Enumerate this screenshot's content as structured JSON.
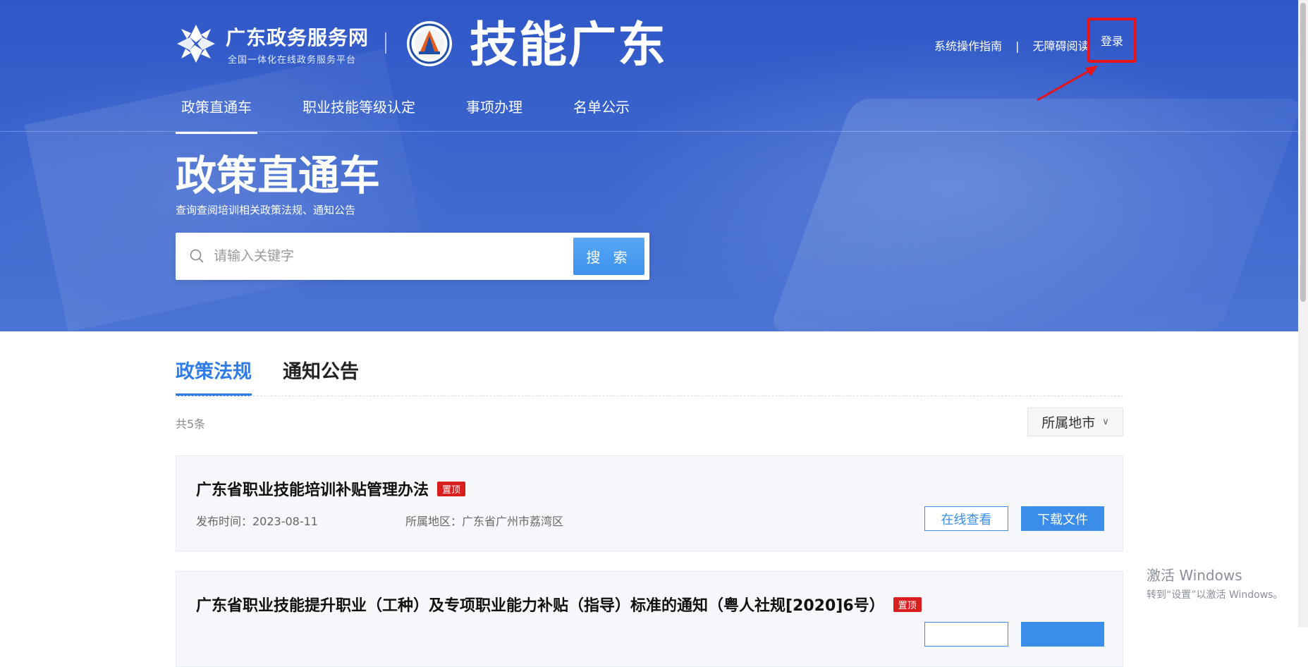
{
  "header": {
    "portal_name": "广东政务服务网",
    "portal_tagline": "全国一体化在线政务服务平台",
    "site_title": "技能广东",
    "links": [
      "系统操作指南",
      "|",
      "无障碍阅读"
    ],
    "login_label": "登录"
  },
  "nav": {
    "items": [
      {
        "label": "政策直通车",
        "active": true
      },
      {
        "label": "职业技能等级认定",
        "active": false
      },
      {
        "label": "事项办理",
        "active": false
      },
      {
        "label": "名单公示",
        "active": false
      }
    ]
  },
  "hero": {
    "title": "政策直通车",
    "subtitle": "查询查阅培训相关政策法规、通知公告"
  },
  "search": {
    "placeholder": "请输入关键字",
    "button_label": "搜 索"
  },
  "tabs": [
    {
      "label": "政策法规",
      "active": true
    },
    {
      "label": "通知公告",
      "active": false
    }
  ],
  "list": {
    "total": "共5条",
    "region_filter": "所属地市",
    "items": [
      {
        "title": "广东省职业技能培训补贴管理办法",
        "badge": "置顶",
        "publish_time": "发布时间：2023-08-11",
        "region": "所属地区：广东省广州市荔湾区",
        "view_label": "在线查看",
        "download_label": "下载文件"
      },
      {
        "title": "广东省职业技能提升职业（工种）及专项职业能力补贴（指导）标准的通知（粤人社规[2020]6号）",
        "badge": "置顶",
        "publish_time": "",
        "region": "",
        "view_label": "",
        "download_label": ""
      }
    ]
  },
  "watermark": {
    "line1": "激活 Windows",
    "line2": "转到“设置”以激活 Windows。"
  },
  "colors": {
    "hero_blue": "#3a63cd",
    "accent_blue": "#2f7ce8",
    "badge_red": "#d81e1e",
    "highlight_red": "#e8141c"
  }
}
